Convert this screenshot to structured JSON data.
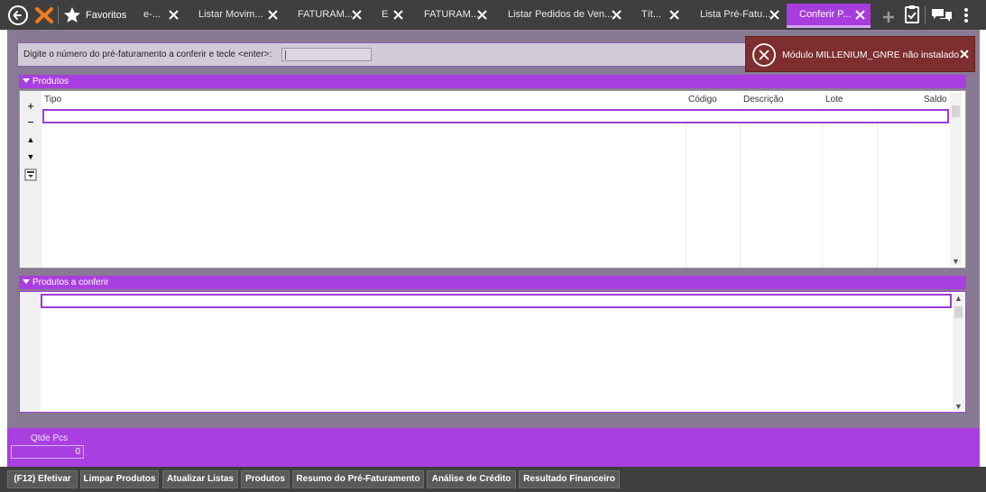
{
  "topbar": {
    "favorites_label": "Favoritos",
    "tabs": [
      {
        "label": "e-...",
        "active": false
      },
      {
        "label": "Listar Movim...",
        "active": false
      },
      {
        "label": "FATURAM...",
        "active": false
      },
      {
        "label": "E",
        "active": false
      },
      {
        "label": "FATURAM...",
        "active": false
      },
      {
        "label": "Listar Pedidos de Ven...",
        "active": false
      },
      {
        "label": "Tít...",
        "active": false
      },
      {
        "label": "Lista Pré-Fatu...",
        "active": false
      },
      {
        "label": "Conferir P...",
        "active": true
      }
    ],
    "icons": [
      "back-icon",
      "logo-icon",
      "star-icon",
      "close-icon",
      "add-tab-icon",
      "clipboard-check-icon",
      "chat-icon",
      "more-vertical-icon"
    ]
  },
  "header": {
    "label": "Digite o número do pré-faturamento a conferir e tecle <enter>:",
    "input_value": ""
  },
  "produtos": {
    "title": "Produtos",
    "columns": [
      "Tipo",
      "Código",
      "Descrição",
      "Lote",
      "Saldo"
    ],
    "tools": [
      "+",
      "−",
      "▲",
      "▼"
    ]
  },
  "produtos_conferir": {
    "title": "Produtos a conferir"
  },
  "qtde": {
    "label": "Qtde Pcs",
    "value": "0"
  },
  "buttons": [
    "(F12) Efetivar",
    "Limpar Produtos",
    "Atualizar Listas",
    "Produtos",
    "Resumo do Pré-Faturamento",
    "Análise de Crédito",
    "Resultado Financeiro"
  ],
  "toast": {
    "message": "Módulo MILLENIUM_GNRE não instalado"
  },
  "colors": {
    "accent": "#a93fe0",
    "topbar": "#3f3f3f",
    "toast": "#7e2e2e"
  }
}
